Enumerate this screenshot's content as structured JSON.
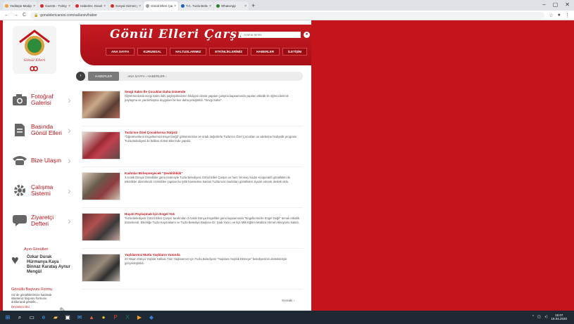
{
  "browser": {
    "tabs": [
      {
        "title": "Yeditepe Medipol",
        "active": false,
        "color": "#e8a23a"
      },
      {
        "title": "Gazete - Türkiye'nin lik",
        "active": false,
        "color": "#d32f2f"
      },
      {
        "title": "Haberler, Gündem ve",
        "active": false,
        "color": "#d32f2f"
      },
      {
        "title": "Sosyal Hizmet yazar",
        "active": false,
        "color": "#d32f2f"
      },
      {
        "title": "Gönül Elleri Çarşısı - Tuzla",
        "active": true,
        "color": "#9e9e9e"
      },
      {
        "title": "T.C. Tuzla Belediyesi",
        "active": false,
        "color": "#1565c0"
      },
      {
        "title": "WhatsApp",
        "active": false,
        "color": "#2e7d32"
      }
    ],
    "url": "gonulelericarsisi.com/sal/arsiv/haber",
    "new_tab": "+",
    "window_controls": [
      "–",
      "▢",
      "✕"
    ]
  },
  "header": {
    "logo_text": "Gönül Elleri",
    "logo_figure": "ꝏ",
    "title": "Gönül Elleri Çarşısı",
    "search_placeholder": "Arama terimi",
    "nav": [
      "ANA SAYFA",
      "KURUMSAL",
      "HALTUSLARIMIZ",
      "ETKİNLİKLERİMİZ",
      "HABERLER",
      "İLETİŞİM"
    ]
  },
  "breadcrumb": {
    "home_icon": "›",
    "active": "HABERLER",
    "sub": "ANA SAYFA › HABERLER ›"
  },
  "menu": [
    {
      "icon": "camera-icon",
      "label": "Fotoğraf Galerisi"
    },
    {
      "icon": "document-icon",
      "label": "Basında Gönül Elleri"
    },
    {
      "icon": "phone-icon",
      "label": "Bize Ulaşın"
    },
    {
      "icon": "gear-icon",
      "label": "Çalışma Sistemi"
    },
    {
      "icon": "chat-icon",
      "label": "Ziyaretçi Defteri"
    }
  ],
  "ayin_gonulleri": {
    "heading": "Ayın Gönülleri",
    "names": "Özkar Durak Hürmanya Kaya Binnaz Karataş Aynur Mengül"
  },
  "gonullu_form": {
    "heading": "Gönüllü Başvuru Formu",
    "desc": "Siz de gönüllülerimize katılmak isterseniz başvuru formunu doldurarak gönüllü...",
    "link": "Devamını oku"
  },
  "news": [
    {
      "title": "Sevgi Saksı İle Çocuklar Daha Güvende",
      "body": "Öğretmenlerde sevgi saksı ilahi paylaşılmasının hikâyesi olarak yapılan çalışma kapsamında yapılan etkinlik ile öğrencilerimiz paylaşma ve yardımlaşma duyguları bir kez daha pekiştirildi. \"Sevgi Saksı\"."
    },
    {
      "title": "Tuzla'nın Özel Çocuklarına Sürpriz",
      "body": "\"Öğretmenlerin Engellerimizi Engel Değil\" göstermesine ve ortak değerlerle Tuzla'nın Özel Çocukları ve ailelerine hediyelik programı Tuzla Belediyesi ile birlikte Gönül Elleri'nde yapıldı."
    },
    {
      "title": "Kadınlar Birleşmeyecek \"Şevkitiliklik\"",
      "body": "3 Aralık Dünya Gönüllüler günü nedeniyle Tuzla Belediyesi Gönül Elleri Çarşısı ve hem Yenisey Kadın Kooperatifi gönüllüleri ile etkinlikler düzenlendi. Gönülden yapılan bu iyilik hareketine katılan Tuzlamızın kadınları gönüllüleri ziyaret ederek destek oldu."
    },
    {
      "title": "Hayati Paylaşmak İçin Engel Yok",
      "body": "Tuzla Belediyesi Gönül Elleri Çarşısı tarafından 3 Aralık Dünya Engelliler günü kapsamında \"Engellerimizle Engel Değil\" temalı etkinlik düzenlendi. Etkinliğe Tuzla Kaymakamı ve Tuzla Belediye Başkanı Dr. Şadi Yazıcı ve ilçe Milli Eğitim Müdürü Ahmet Akkoyunlu katıldı."
    },
    {
      "title": "Yaşlılarımız Mutlu Yaşlıların Yanında",
      "body": "20 Nisan Dünya Yaşlılar Haftası Tüm Yaşlılarımız için Tuzla Belediyesi \"Yaşlılara Yaşlılık Ekmeye\" belediyesinin destekleriyle gerçekleştirildi."
    }
  ],
  "pagination": "Sonraki ›",
  "taskbar": {
    "icons": [
      "windows-icon",
      "search-icon",
      "task-view-icon",
      "edge-icon",
      "file-explorer-icon",
      "store-icon",
      "mail-icon",
      "photos-icon",
      "chrome-icon",
      "powerpoint-icon",
      "excel-icon",
      "player-icon",
      "chat-app-icon"
    ],
    "time": "15:07",
    "date": "16.04.2020"
  }
}
